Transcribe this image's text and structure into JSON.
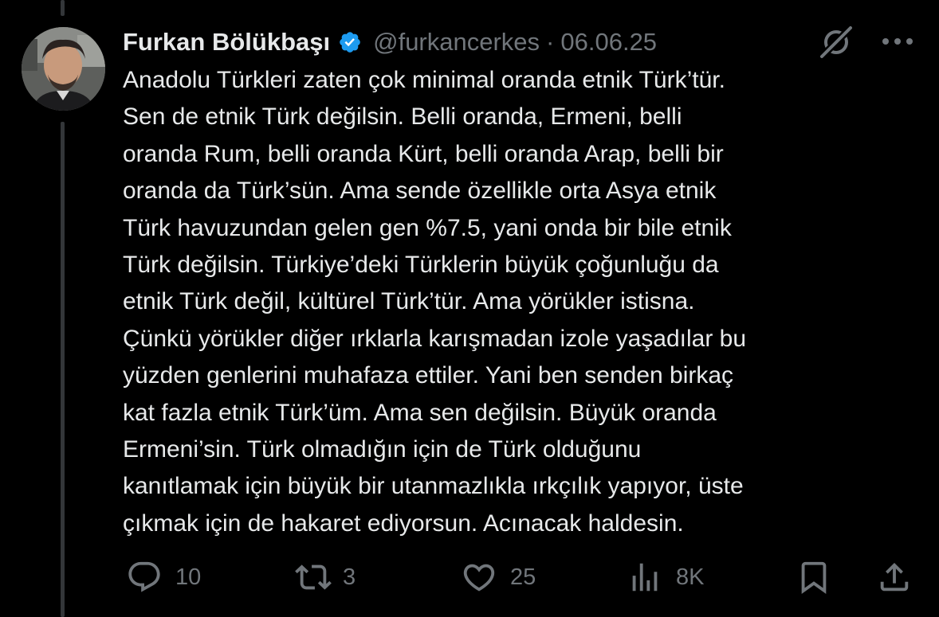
{
  "author": {
    "display_name": "Furkan Bölükbaşı",
    "handle": "@furkancerkes",
    "separator": "·",
    "date": "06.06.25",
    "verified": true
  },
  "tweet": {
    "text": "Anadolu Türkleri zaten çok minimal oranda etnik Türk’tür.\nSen de etnik Türk değilsin. Belli oranda, Ermeni, belli\noranda Rum, belli oranda Kürt, belli oranda Arap, belli bir\noranda da Türk’sün. Ama sende özellikle orta Asya etnik\nTürk havuzundan gelen gen %7.5, yani onda bir bile etnik\nTürk değilsin. Türkiye’deki Türklerin büyük çoğunluğu da\netnik Türk değil, kültürel Türk’tür. Ama yörükler istisna.\nÇünkü yörükler diğer ırklarla karışmadan izole yaşadılar bu\nyüzden genlerini muhafaza ettiler. Yani ben senden birkaç\nkat fazla etnik Türk’üm. Ama sen değilsin. Büyük oranda\nErmeni’sin. Türk olmadığın için de Türk olduğunu\nkanıtlamak için büyük bir utanmazlıkla ırkçılık yapıyor, üste\nçıkmak için de hakaret ediyorsun. Acınacak haldesin."
  },
  "actions": {
    "replies": "10",
    "reposts": "3",
    "likes": "25",
    "views": "8K"
  },
  "icons": {
    "verified": "verified-badge-icon",
    "grok": "grok-icon",
    "more": "more-options-icon",
    "reply": "reply-icon",
    "repost": "repost-icon",
    "like": "heart-icon",
    "views": "views-chart-icon",
    "bookmark": "bookmark-icon",
    "share": "share-icon"
  },
  "colors": {
    "background": "#000000",
    "text_primary": "#e7e9ea",
    "text_secondary": "#71767b",
    "verified_blue": "#1d9bf0",
    "thread_line": "#333639"
  }
}
